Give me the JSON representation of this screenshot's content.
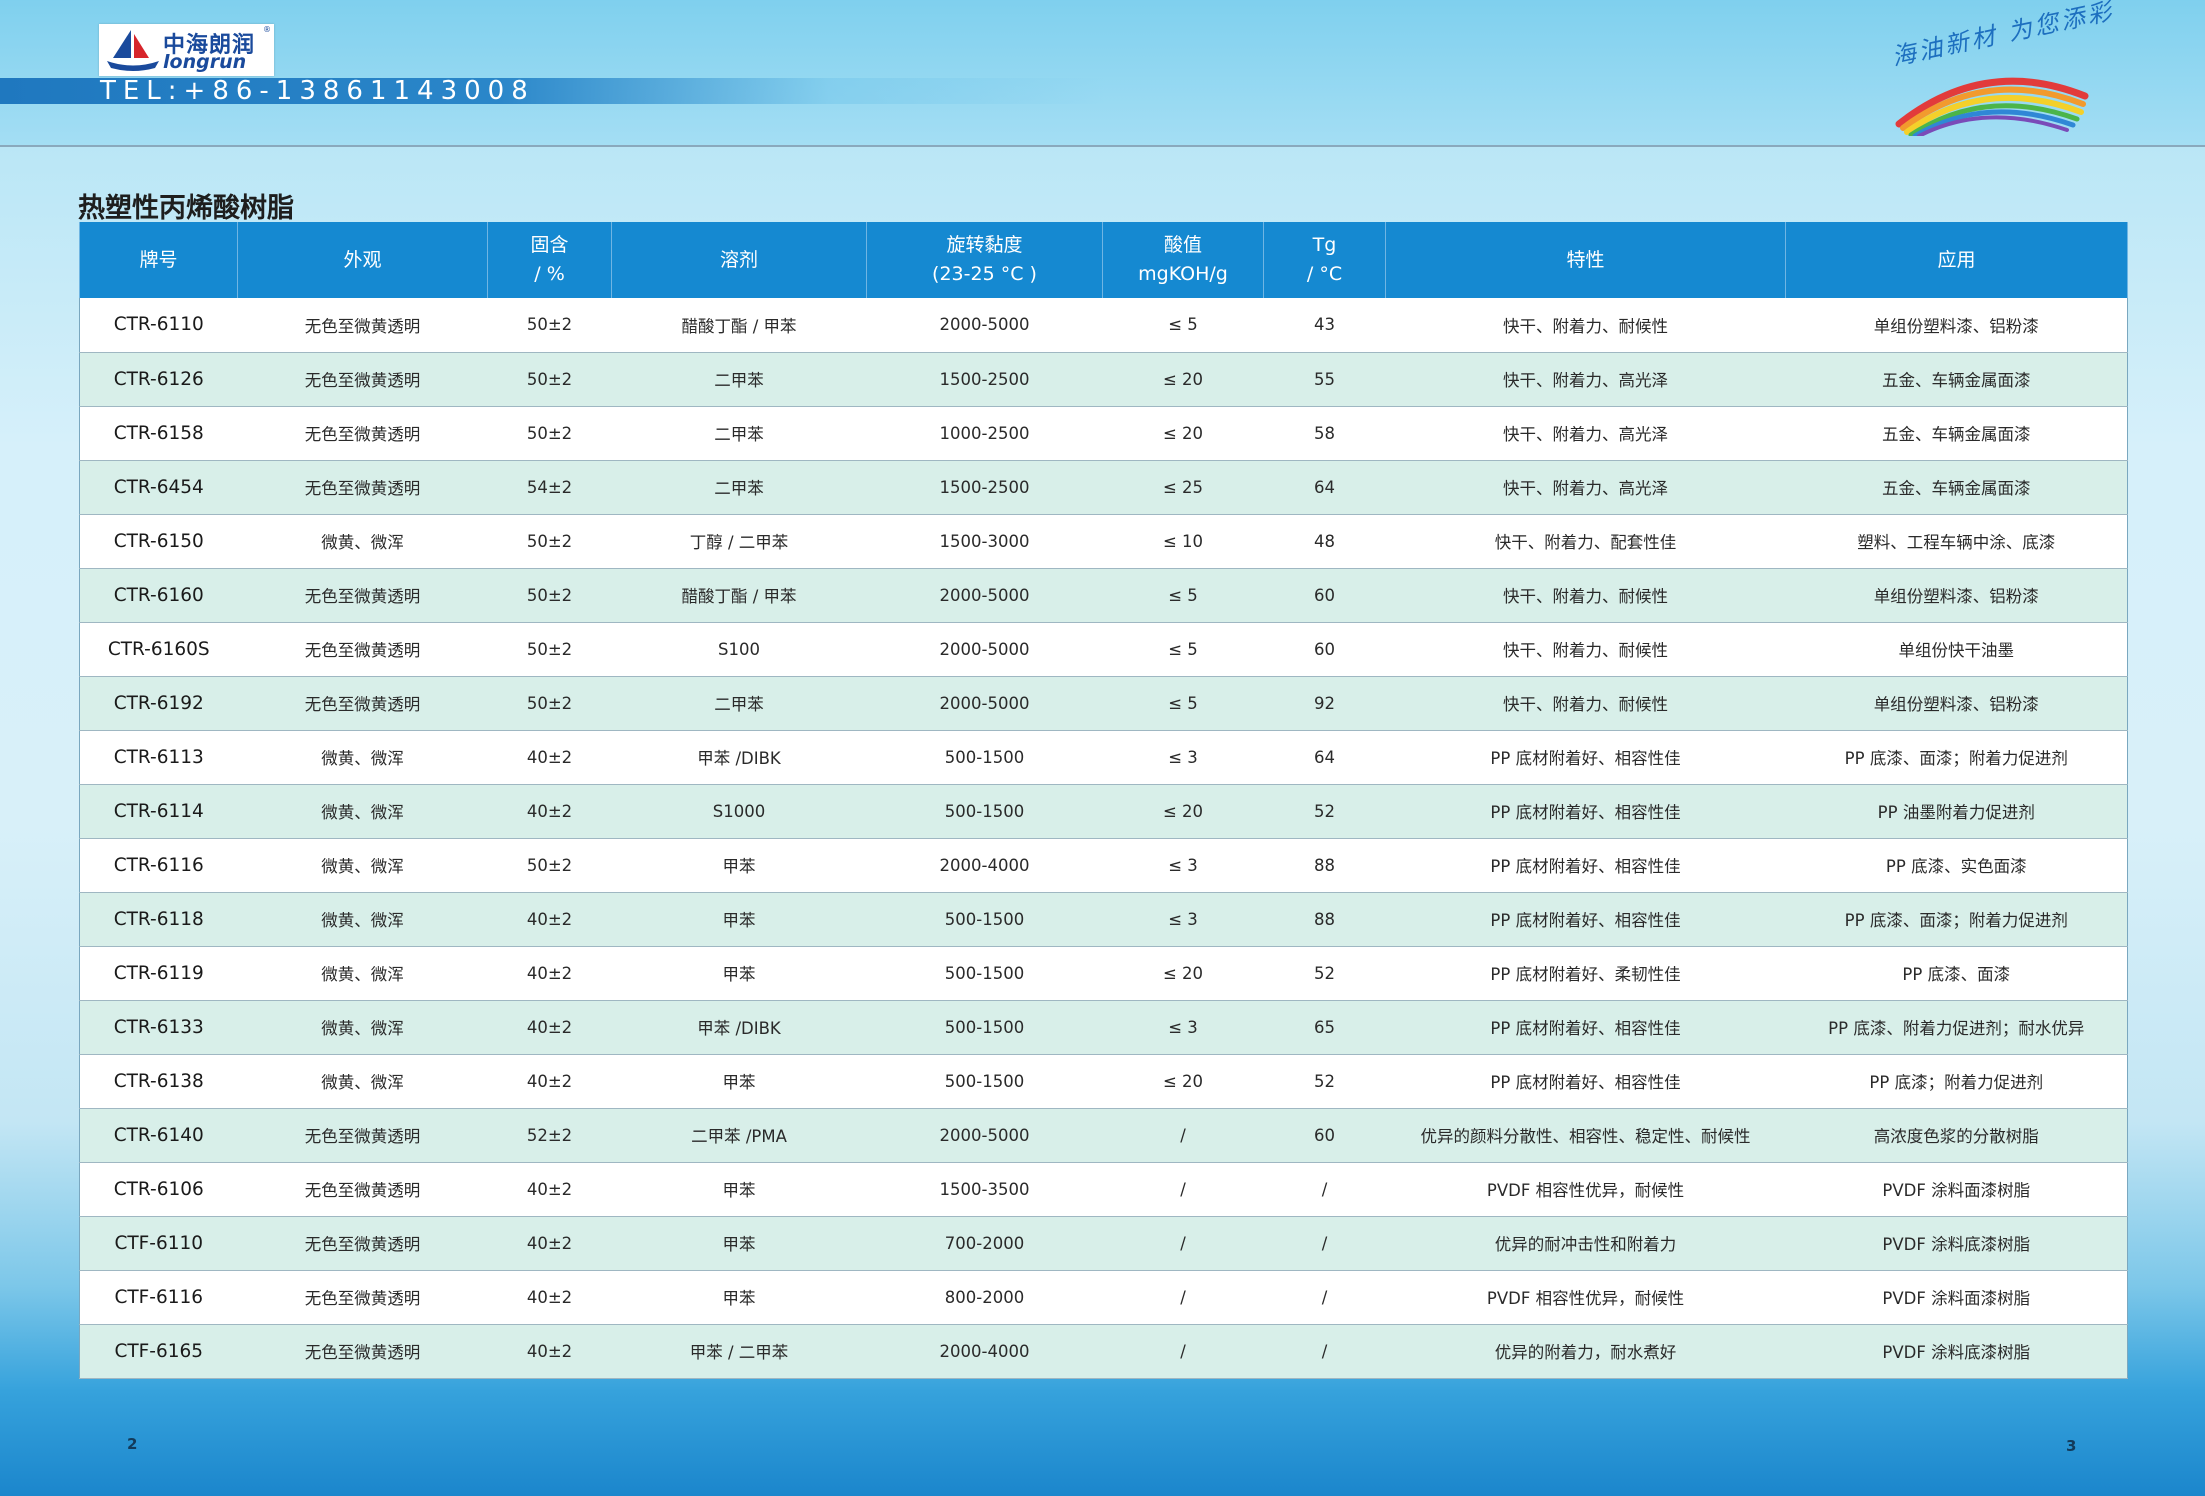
{
  "header": {
    "logo_cn": "中海朗润",
    "logo_en": "longrun",
    "logo_reg": "®",
    "tel": "TEL:+86-13861143008",
    "slogan": "海油新材 为您添彩"
  },
  "section_title": "热塑性丙烯酸树脂",
  "table": {
    "headers": [
      {
        "l1": "牌号",
        "l2": ""
      },
      {
        "l1": "外观",
        "l2": ""
      },
      {
        "l1": "固含",
        "l2": "/ %"
      },
      {
        "l1": "溶剂",
        "l2": ""
      },
      {
        "l1": "旋转黏度",
        "l2": "(23-25 °C )"
      },
      {
        "l1": "酸值",
        "l2": "mgKOH/g"
      },
      {
        "l1": "Tg",
        "l2": "/ °C"
      },
      {
        "l1": "特性",
        "l2": ""
      },
      {
        "l1": "应用",
        "l2": ""
      }
    ],
    "rows": [
      [
        "CTR-6110",
        "无色至微黄透明",
        "50±2",
        "醋酸丁酯 / 甲苯",
        "2000-5000",
        "≤ 5",
        "43",
        "快干、附着力、耐候性",
        "单组份塑料漆、铝粉漆"
      ],
      [
        "CTR-6126",
        "无色至微黄透明",
        "50±2",
        "二甲苯",
        "1500-2500",
        "≤ 20",
        "55",
        "快干、附着力、高光泽",
        "五金、车辆金属面漆"
      ],
      [
        "CTR-6158",
        "无色至微黄透明",
        "50±2",
        "二甲苯",
        "1000-2500",
        "≤ 20",
        "58",
        "快干、附着力、高光泽",
        "五金、车辆金属面漆"
      ],
      [
        "CTR-6454",
        "无色至微黄透明",
        "54±2",
        "二甲苯",
        "1500-2500",
        "≤ 25",
        "64",
        "快干、附着力、高光泽",
        "五金、车辆金属面漆"
      ],
      [
        "CTR-6150",
        "微黄、微浑",
        "50±2",
        "丁醇 / 二甲苯",
        "1500-3000",
        "≤ 10",
        "48",
        "快干、附着力、配套性佳",
        "塑料、工程车辆中涂、底漆"
      ],
      [
        "CTR-6160",
        "无色至微黄透明",
        "50±2",
        "醋酸丁酯 / 甲苯",
        "2000-5000",
        "≤ 5",
        "60",
        "快干、附着力、耐候性",
        "单组份塑料漆、铝粉漆"
      ],
      [
        "CTR-6160S",
        "无色至微黄透明",
        "50±2",
        "S100",
        "2000-5000",
        "≤ 5",
        "60",
        "快干、附着力、耐候性",
        "单组份快干油墨"
      ],
      [
        "CTR-6192",
        "无色至微黄透明",
        "50±2",
        "二甲苯",
        "2000-5000",
        "≤ 5",
        "92",
        "快干、附着力、耐候性",
        "单组份塑料漆、铝粉漆"
      ],
      [
        "CTR-6113",
        "微黄、微浑",
        "40±2",
        "甲苯 /DIBK",
        "500-1500",
        "≤ 3",
        "64",
        "PP 底材附着好、相容性佳",
        "PP 底漆、面漆；附着力促进剂"
      ],
      [
        "CTR-6114",
        "微黄、微浑",
        "40±2",
        "S1000",
        "500-1500",
        "≤ 20",
        "52",
        "PP 底材附着好、相容性佳",
        "PP 油墨附着力促进剂"
      ],
      [
        "CTR-6116",
        "微黄、微浑",
        "50±2",
        "甲苯",
        "2000-4000",
        "≤ 3",
        "88",
        "PP 底材附着好、相容性佳",
        "PP 底漆、实色面漆"
      ],
      [
        "CTR-6118",
        "微黄、微浑",
        "40±2",
        "甲苯",
        "500-1500",
        "≤ 3",
        "88",
        "PP 底材附着好、相容性佳",
        "PP 底漆、面漆；附着力促进剂"
      ],
      [
        "CTR-6119",
        "微黄、微浑",
        "40±2",
        "甲苯",
        "500-1500",
        "≤ 20",
        "52",
        "PP 底材附着好、柔韧性佳",
        "PP 底漆、面漆"
      ],
      [
        "CTR-6133",
        "微黄、微浑",
        "40±2",
        "甲苯 /DIBK",
        "500-1500",
        "≤ 3",
        "65",
        "PP 底材附着好、相容性佳",
        "PP 底漆、附着力促进剂；耐水优异"
      ],
      [
        "CTR-6138",
        "微黄、微浑",
        "40±2",
        "甲苯",
        "500-1500",
        "≤ 20",
        "52",
        "PP 底材附着好、相容性佳",
        "PP 底漆；附着力促进剂"
      ],
      [
        "CTR-6140",
        "无色至微黄透明",
        "52±2",
        "二甲苯 /PMA",
        "2000-5000",
        "/",
        "60",
        "优异的颜料分散性、相容性、稳定性、耐候性",
        "高浓度色浆的分散树脂"
      ],
      [
        "CTR-6106",
        "无色至微黄透明",
        "40±2",
        "甲苯",
        "1500-3500",
        "/",
        "/",
        "PVDF 相容性优异，耐候性",
        "PVDF 涂料面漆树脂"
      ],
      [
        "CTF-6110",
        "无色至微黄透明",
        "40±2",
        "甲苯",
        "700-2000",
        "/",
        "/",
        "优异的耐冲击性和附着力",
        "PVDF 涂料底漆树脂"
      ],
      [
        "CTF-6116",
        "无色至微黄透明",
        "40±2",
        "甲苯",
        "800-2000",
        "/",
        "/",
        "PVDF 相容性优异，耐候性",
        "PVDF 涂料面漆树脂"
      ],
      [
        "CTF-6165",
        "无色至微黄透明",
        "40±2",
        "甲苯 / 二甲苯",
        "2000-4000",
        "/",
        "/",
        "优异的附着力，耐水煮好",
        "PVDF 涂料底漆树脂"
      ]
    ]
  },
  "page_left": "2",
  "page_right": "3"
}
